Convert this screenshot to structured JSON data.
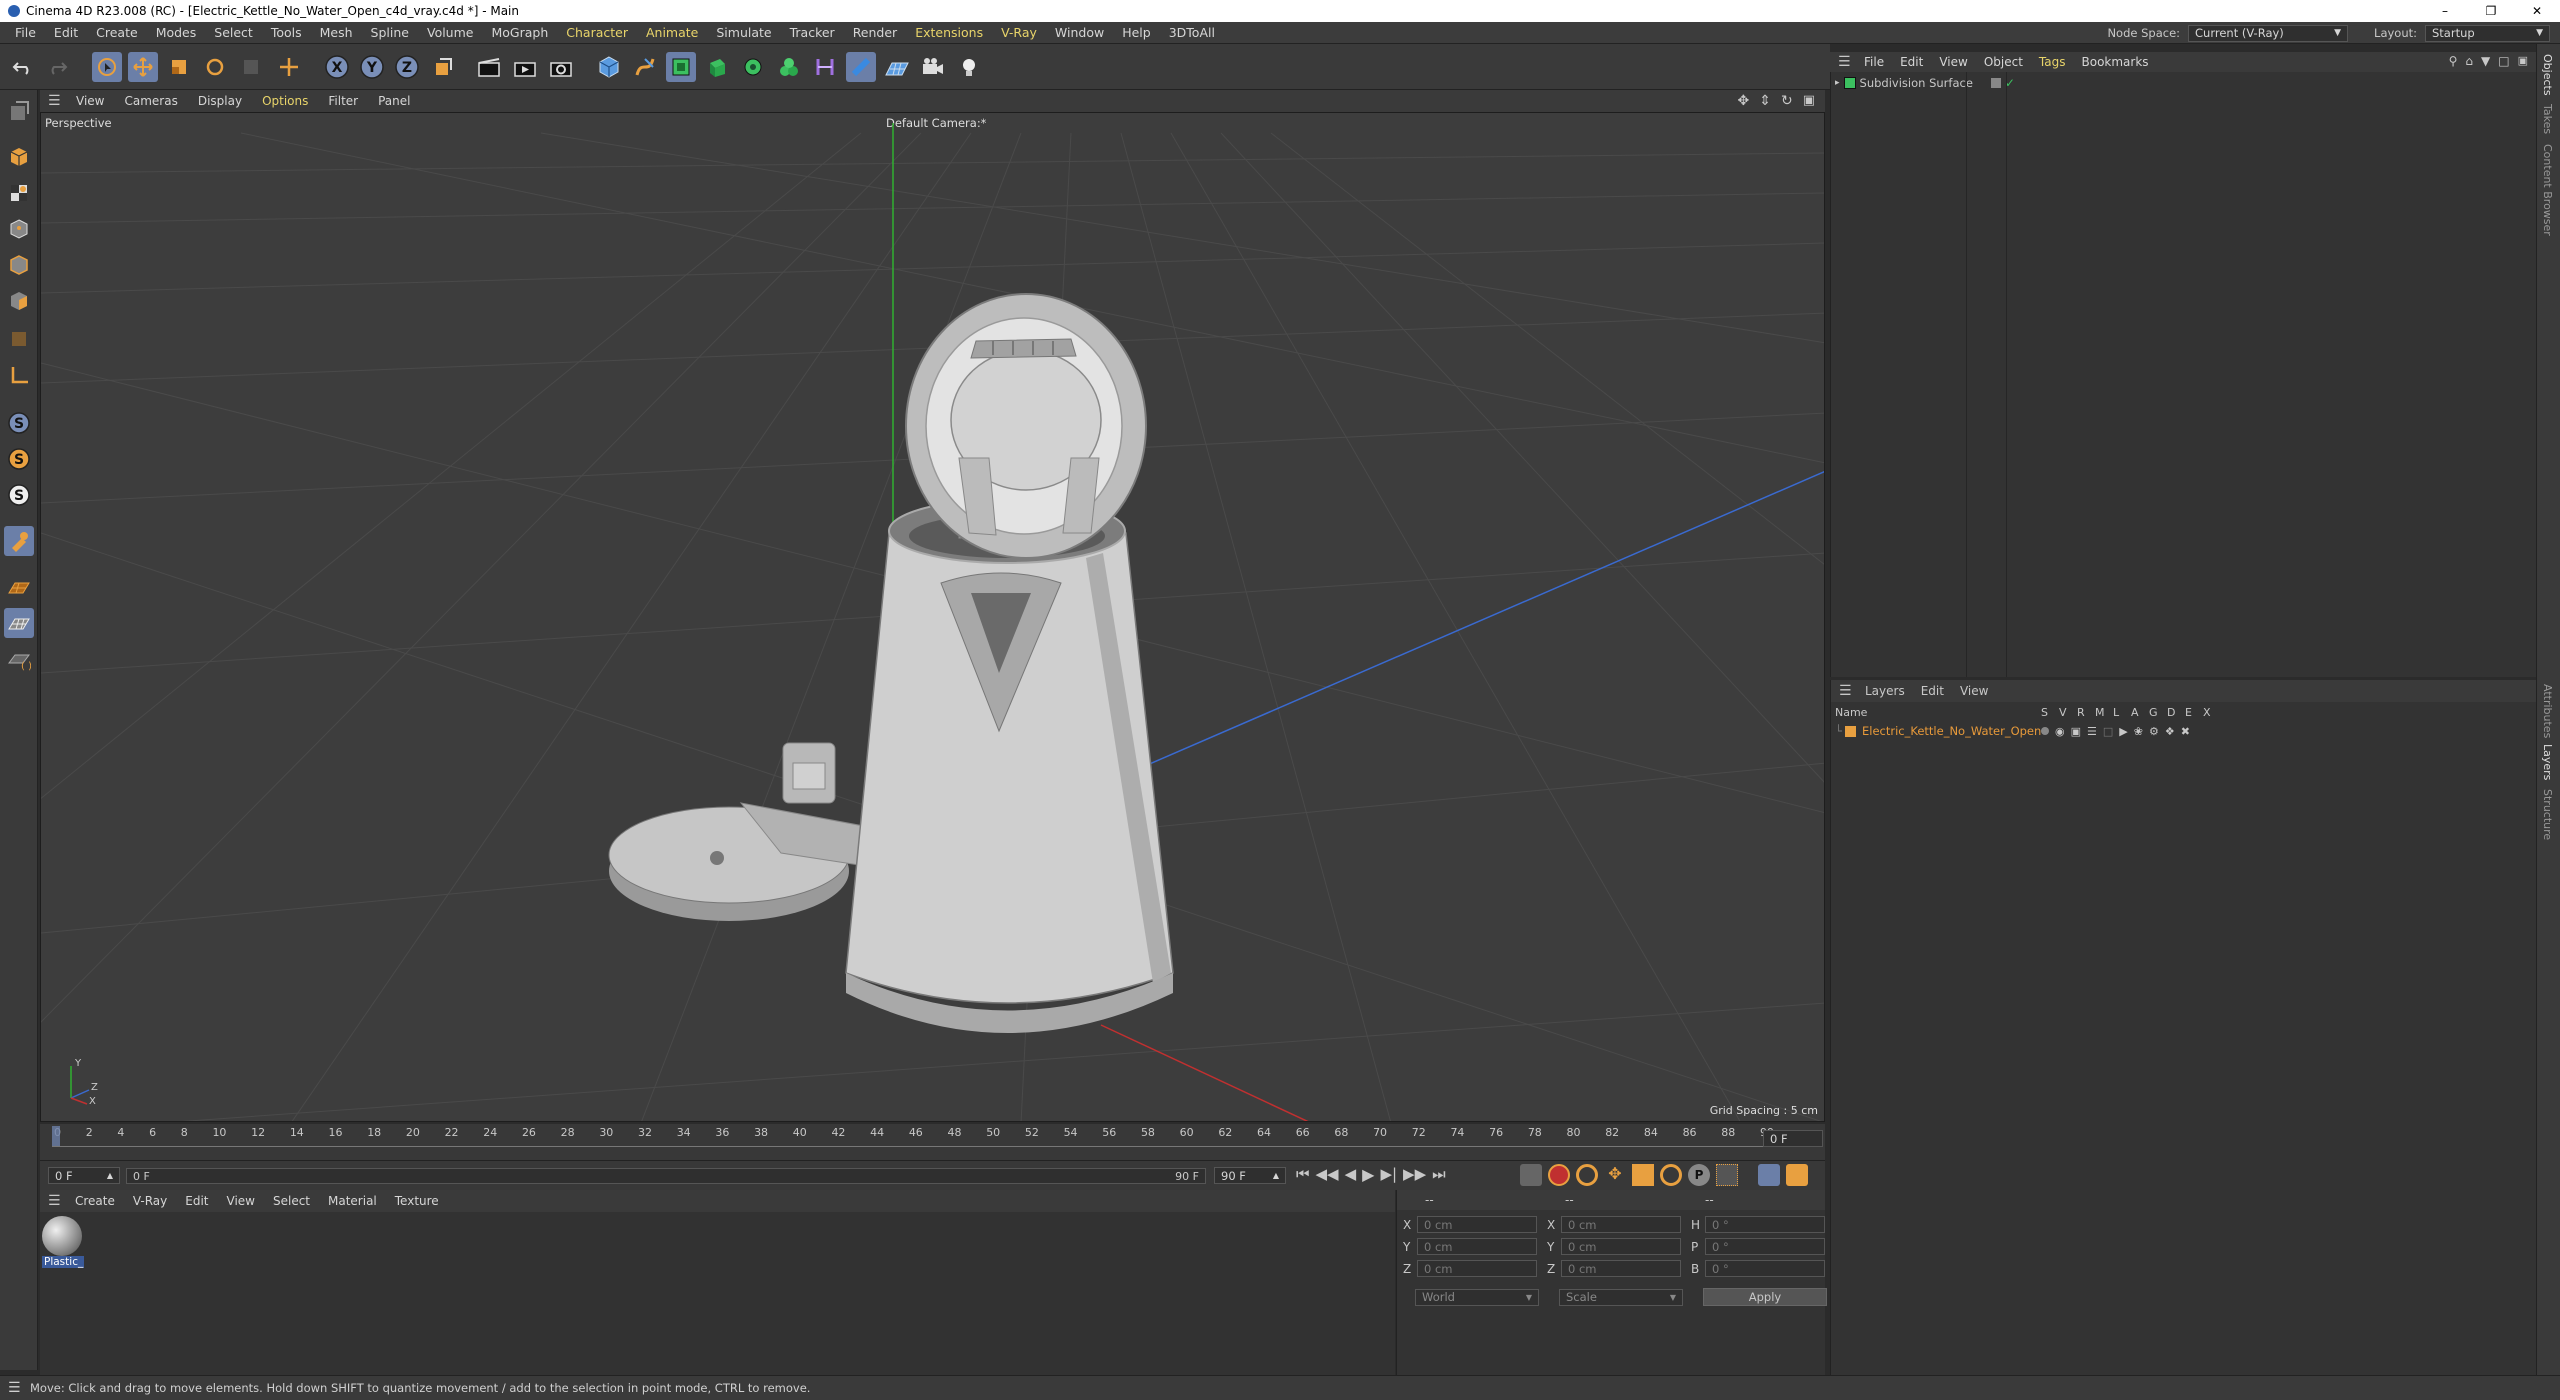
{
  "window": {
    "title": "Cinema 4D R23.008 (RC) - [Electric_Kettle_No_Water_Open_c4d_vray.c4d *] - Main",
    "controls": [
      "–",
      "❐",
      "✕"
    ]
  },
  "menu": {
    "items": [
      "File",
      "Edit",
      "Create",
      "Modes",
      "Select",
      "Tools",
      "Mesh",
      "Spline",
      "Volume",
      "MoGraph",
      "Character",
      "Animate",
      "Simulate",
      "Tracker",
      "Render",
      "Extensions",
      "V-Ray",
      "Window",
      "Help",
      "3DToAll"
    ],
    "highlighted": [
      "Character",
      "Animate",
      "Extensions",
      "V-Ray"
    ],
    "node_space_label": "Node Space:",
    "node_space_value": "Current (V-Ray)",
    "layout_label": "Layout:",
    "layout_value": "Startup"
  },
  "viewport": {
    "menu": [
      "View",
      "Cameras",
      "Display",
      "Options",
      "Filter",
      "Panel"
    ],
    "view_name": "Perspective",
    "camera": "Default Camera",
    "camera_suffix": ":*",
    "grid_spacing": "Grid Spacing : 5 cm",
    "axis_labels": [
      "Y",
      "Z",
      "X"
    ]
  },
  "timeline": {
    "ticks": [
      "0",
      "2",
      "4",
      "6",
      "8",
      "10",
      "12",
      "14",
      "16",
      "18",
      "20",
      "22",
      "24",
      "26",
      "28",
      "30",
      "32",
      "34",
      "36",
      "38",
      "40",
      "42",
      "44",
      "46",
      "48",
      "50",
      "52",
      "54",
      "56",
      "58",
      "60",
      "62",
      "64",
      "66",
      "68",
      "70",
      "72",
      "74",
      "76",
      "78",
      "80",
      "82",
      "84",
      "86",
      "88",
      "90"
    ],
    "current_frame": "0 F",
    "start_frame": "0 F",
    "preview_start": "0 F",
    "preview_end": "90 F",
    "end_frame": "90 F"
  },
  "materials": {
    "menu": [
      "Create",
      "V-Ray",
      "Edit",
      "View",
      "Select",
      "Material",
      "Texture"
    ],
    "items": [
      {
        "name": "Plastic_E"
      }
    ]
  },
  "coordinates": {
    "header": [
      "--",
      "--",
      "--"
    ],
    "rows": [
      {
        "axis": "X",
        "pos": "0 cm",
        "axis2": "X",
        "size": "0 cm",
        "axis3": "H",
        "rot": "0 °"
      },
      {
        "axis": "Y",
        "pos": "0 cm",
        "axis2": "Y",
        "size": "0 cm",
        "axis3": "P",
        "rot": "0 °"
      },
      {
        "axis": "Z",
        "pos": "0 cm",
        "axis2": "Z",
        "size": "0 cm",
        "axis3": "B",
        "rot": "0 °"
      }
    ],
    "mode": "World",
    "transform": "Scale",
    "apply": "Apply"
  },
  "objects": {
    "menu": [
      "File",
      "Edit",
      "View",
      "Object",
      "Tags",
      "Bookmarks"
    ],
    "items": [
      {
        "name": "Subdivision Surface"
      }
    ]
  },
  "layers": {
    "menu": [
      "Layers",
      "Edit",
      "View"
    ],
    "name_header": "Name",
    "columns": [
      "S",
      "V",
      "R",
      "M",
      "L",
      "A",
      "G",
      "D",
      "E",
      "X"
    ],
    "items": [
      {
        "name": "Electric_Kettle_No_Water_Open"
      }
    ]
  },
  "right_tabs": [
    "Objects",
    "Takes",
    "Content Browser",
    "Attributes",
    "Layers",
    "Structure"
  ],
  "status": "Move: Click and drag to move elements. Hold down SHIFT to quantize movement / add to the selection in point mode, CTRL to remove.",
  "colors": {
    "accent": "#e8a040",
    "layer_name": "#e89a3a",
    "x_axis": "#c03030",
    "y_axis": "#30b030",
    "z_axis": "#3a6ad0"
  }
}
